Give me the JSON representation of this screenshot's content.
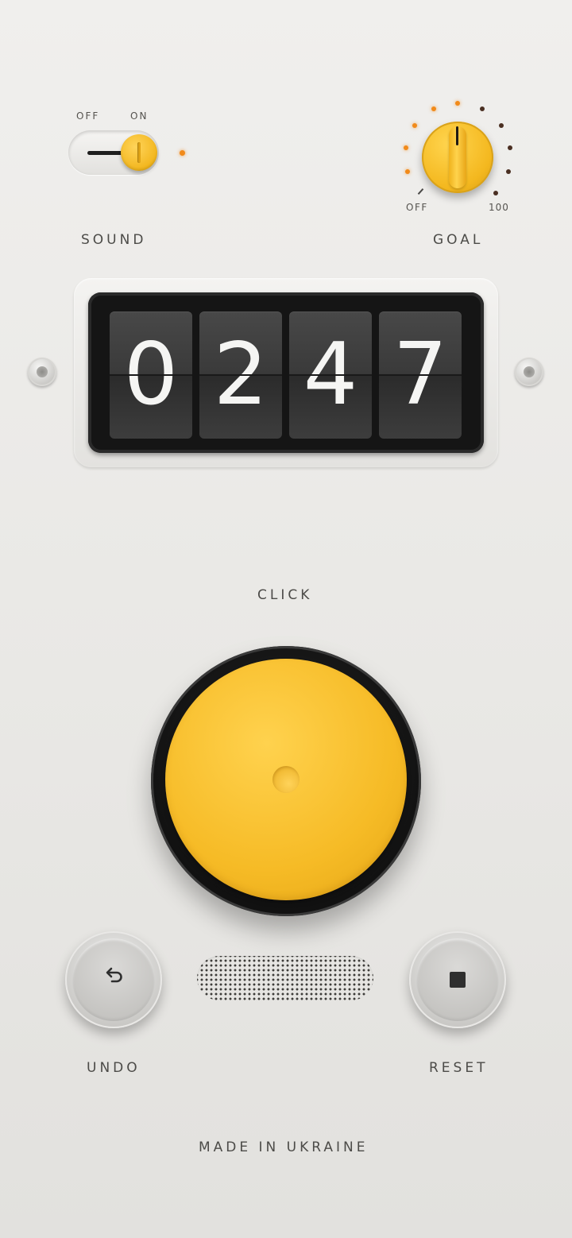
{
  "sound": {
    "label": "SOUND",
    "off_label": "OFF",
    "on_label": "ON",
    "state": "on"
  },
  "goal": {
    "label": "GOAL",
    "min_label": "OFF",
    "max_label": "100",
    "lit_dots": 6,
    "total_dots": 12
  },
  "counter": {
    "digits": [
      "0",
      "2",
      "4",
      "7"
    ]
  },
  "click": {
    "label": "CLICK"
  },
  "undo": {
    "label": "UNDO",
    "icon": "undo-arrow-icon"
  },
  "reset": {
    "label": "RESET",
    "icon": "stop-square-icon"
  },
  "footer": {
    "text": "MADE IN UKRAINE"
  },
  "colors": {
    "accent_yellow": "#f4b81f",
    "led_orange": "#f18a1a",
    "background": "#ebeae7",
    "counter_dark": "#151515"
  }
}
